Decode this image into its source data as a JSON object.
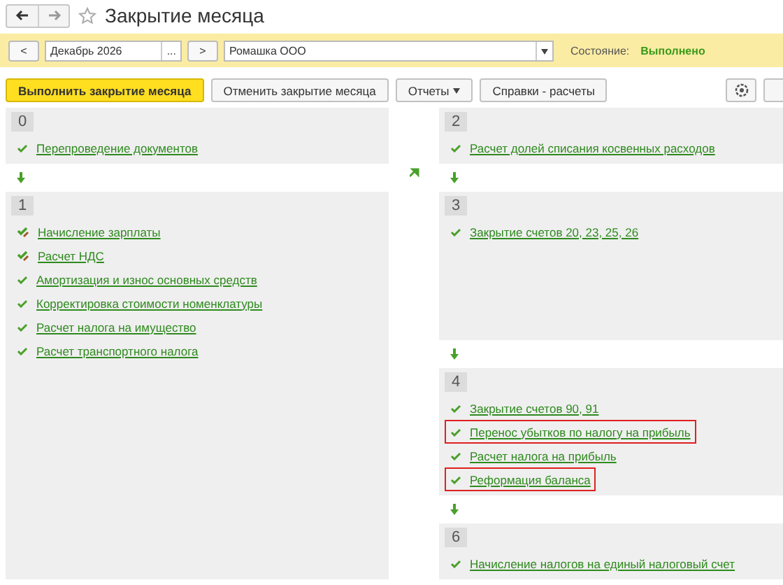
{
  "window": {
    "title": "Закрытие месяца",
    "favorite": false
  },
  "filter": {
    "prev": "<",
    "period": "Декабрь 2026",
    "pick": "...",
    "next": ">",
    "organization": "Ромашка ООО",
    "status_label": "Состояние:",
    "status": "Выполнено"
  },
  "toolbar": [
    {
      "label": "Выполнить закрытие месяца",
      "kind": "primary"
    },
    {
      "label": "Отменить закрытие месяца",
      "kind": "plain"
    },
    {
      "label": "Отчеты",
      "kind": "menu"
    },
    {
      "label": "Справки - расчеты",
      "kind": "plain"
    }
  ],
  "columns": [
    {
      "steps": [
        {
          "number": "0",
          "items": [
            {
              "label": "Перепроведение документов",
              "kind": "check",
              "highlighted": false
            }
          ]
        },
        {
          "number": "1",
          "items": [
            {
              "label": "Начисление зарплаты",
              "kind": "edited",
              "highlighted": false
            },
            {
              "label": "Расчет НДС",
              "kind": "edited",
              "highlighted": false
            },
            {
              "label": "Амортизация и износ основных средств",
              "kind": "check",
              "highlighted": false
            },
            {
              "label": "Корректировка стоимости номенклатуры",
              "kind": "check",
              "highlighted": false
            },
            {
              "label": "Расчет налога на имущество",
              "kind": "check",
              "highlighted": false
            },
            {
              "label": "Расчет транспортного налога",
              "kind": "check",
              "highlighted": false
            }
          ]
        }
      ]
    },
    {
      "steps": [
        {
          "number": "2",
          "items": [
            {
              "label": "Расчет долей списания косвенных расходов",
              "kind": "check",
              "highlighted": false
            }
          ]
        },
        {
          "number": "3",
          "items": [
            {
              "label": "Закрытие счетов 20, 23, 25, 26",
              "kind": "check",
              "highlighted": false
            }
          ]
        },
        {
          "number": "4",
          "items": [
            {
              "label": "Закрытие счетов 90, 91",
              "kind": "check",
              "highlighted": false
            },
            {
              "label": "Перенос убытков по налогу на прибыль",
              "kind": "check",
              "highlighted": true
            },
            {
              "label": "Расчет налога на прибыль",
              "kind": "check",
              "highlighted": false
            },
            {
              "label": "Реформация баланса",
              "kind": "check",
              "highlighted": true
            }
          ]
        },
        {
          "number": "6",
          "items": [
            {
              "label": "Начисление налогов на единый налоговый счет",
              "kind": "check",
              "highlighted": false
            }
          ]
        }
      ]
    }
  ]
}
